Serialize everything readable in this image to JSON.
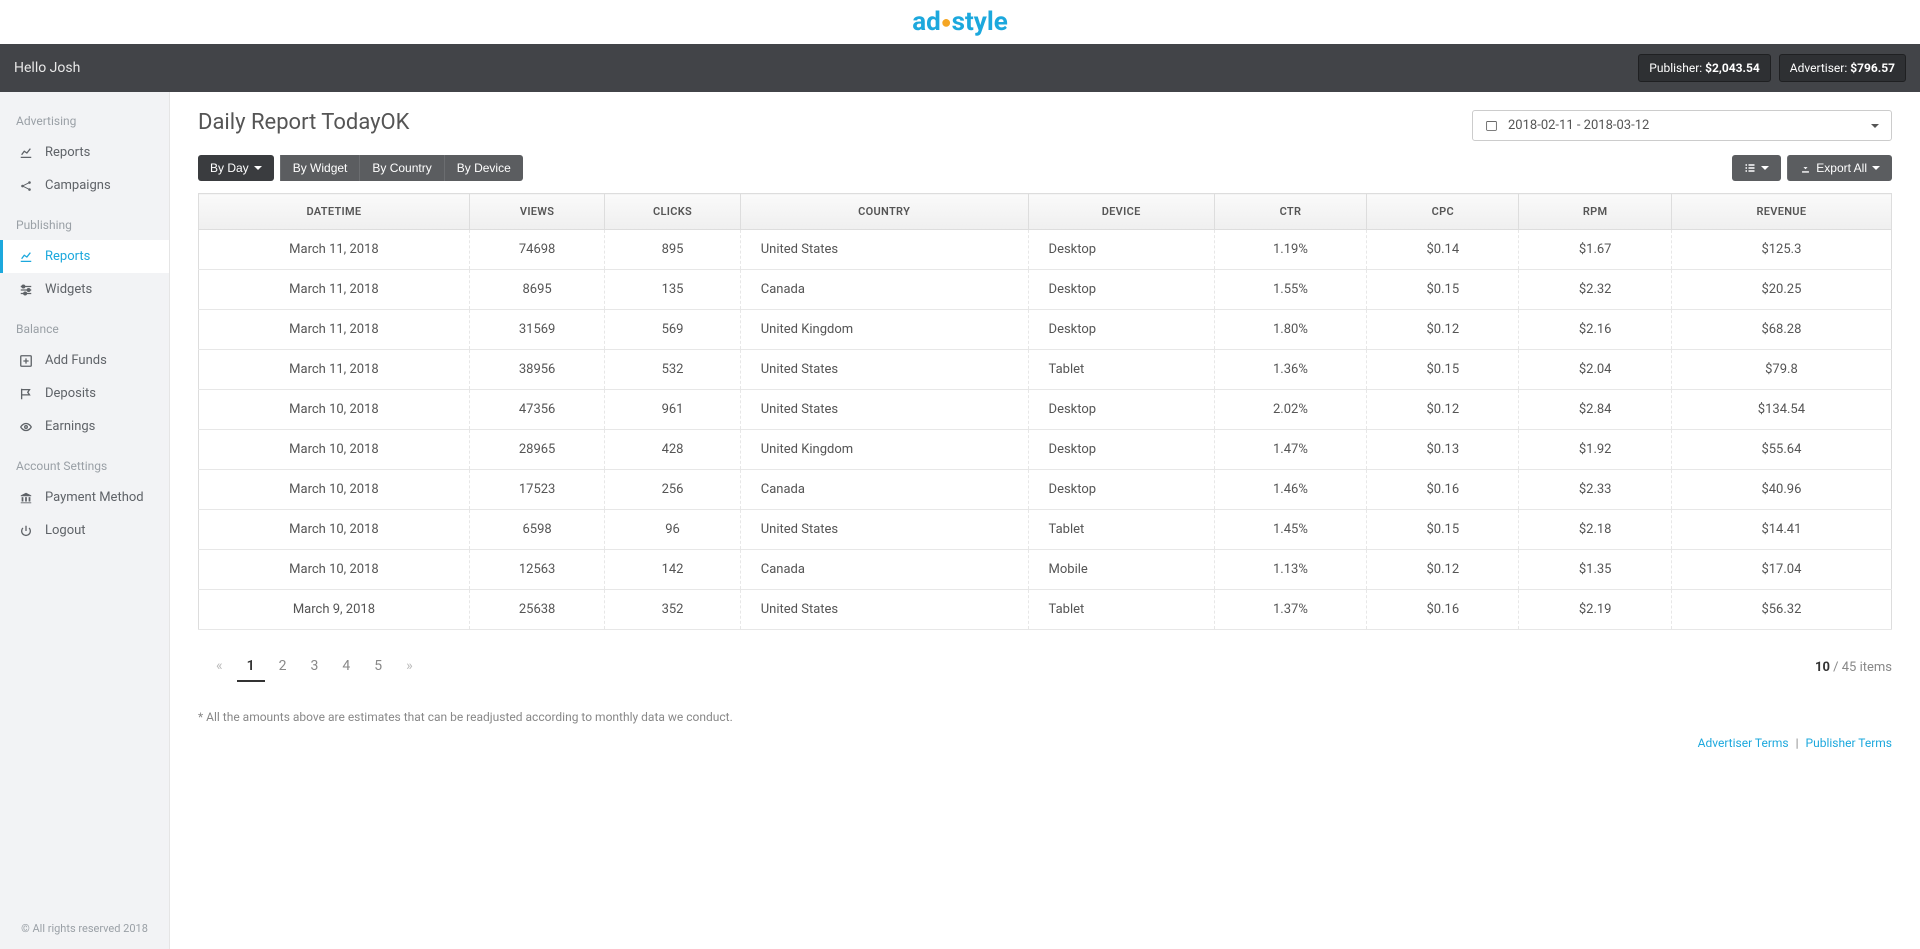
{
  "logo": {
    "part1": "ad",
    "part2": "style"
  },
  "header": {
    "greeting": "Hello Josh",
    "publisher_label": "Publisher: ",
    "publisher_value": "$2,043.54",
    "advertiser_label": "Advertiser: ",
    "advertiser_value": "$796.57"
  },
  "sidebar": {
    "advertising": {
      "heading": "Advertising",
      "reports": "Reports",
      "campaigns": "Campaigns"
    },
    "publishing": {
      "heading": "Publishing",
      "reports": "Reports",
      "widgets": "Widgets"
    },
    "balance": {
      "heading": "Balance",
      "add_funds": "Add Funds",
      "deposits": "Deposits",
      "earnings": "Earnings"
    },
    "account": {
      "heading": "Account Settings",
      "payment": "Payment Method",
      "logout": "Logout"
    },
    "copyright": "© All rights reserved 2018"
  },
  "page": {
    "title": "Daily Report TodayOK",
    "date_range": "2018-02-11 - 2018-03-12",
    "filters": {
      "by_day": "By Day",
      "by_widget": "By Widget",
      "by_country": "By Country",
      "by_device": "By Device"
    },
    "export": "Export All",
    "disclaimer": "* All the amounts above are estimates that can be readjusted according to monthly data we conduct.",
    "footer": {
      "adv_terms": "Advertiser Terms",
      "pub_terms": "Publisher Terms"
    }
  },
  "table": {
    "headers": {
      "datetime": "DATETIME",
      "views": "VIEWS",
      "clicks": "CLICKS",
      "country": "COUNTRY",
      "device": "DEVICE",
      "ctr": "CTR",
      "cpc": "CPC",
      "rpm": "RPM",
      "revenue": "REVENUE"
    },
    "rows": [
      {
        "datetime": "March 11, 2018",
        "views": "74698",
        "clicks": "895",
        "country": "United States",
        "device": "Desktop",
        "ctr": "1.19%",
        "cpc": "$0.14",
        "rpm": "$1.67",
        "revenue": "$125.3"
      },
      {
        "datetime": "March 11, 2018",
        "views": "8695",
        "clicks": "135",
        "country": "Canada",
        "device": "Desktop",
        "ctr": "1.55%",
        "cpc": "$0.15",
        "rpm": "$2.32",
        "revenue": "$20.25"
      },
      {
        "datetime": "March 11, 2018",
        "views": "31569",
        "clicks": "569",
        "country": "United Kingdom",
        "device": "Desktop",
        "ctr": "1.80%",
        "cpc": "$0.12",
        "rpm": "$2.16",
        "revenue": "$68.28"
      },
      {
        "datetime": "March 11, 2018",
        "views": "38956",
        "clicks": "532",
        "country": "United States",
        "device": "Tablet",
        "ctr": "1.36%",
        "cpc": "$0.15",
        "rpm": "$2.04",
        "revenue": "$79.8"
      },
      {
        "datetime": "March 10, 2018",
        "views": "47356",
        "clicks": "961",
        "country": "United States",
        "device": "Desktop",
        "ctr": "2.02%",
        "cpc": "$0.12",
        "rpm": "$2.84",
        "revenue": "$134.54"
      },
      {
        "datetime": "March 10, 2018",
        "views": "28965",
        "clicks": "428",
        "country": "United Kingdom",
        "device": "Desktop",
        "ctr": "1.47%",
        "cpc": "$0.13",
        "rpm": "$1.92",
        "revenue": "$55.64"
      },
      {
        "datetime": "March 10, 2018",
        "views": "17523",
        "clicks": "256",
        "country": "Canada",
        "device": "Desktop",
        "ctr": "1.46%",
        "cpc": "$0.16",
        "rpm": "$2.33",
        "revenue": "$40.96"
      },
      {
        "datetime": "March 10, 2018",
        "views": "6598",
        "clicks": "96",
        "country": "United States",
        "device": "Tablet",
        "ctr": "1.45%",
        "cpc": "$0.15",
        "rpm": "$2.18",
        "revenue": "$14.41"
      },
      {
        "datetime": "March 10, 2018",
        "views": "12563",
        "clicks": "142",
        "country": "Canada",
        "device": "Mobile",
        "ctr": "1.13%",
        "cpc": "$0.12",
        "rpm": "$1.35",
        "revenue": "$17.04"
      },
      {
        "datetime": "March 9, 2018",
        "views": "25638",
        "clicks": "352",
        "country": "United States",
        "device": "Tablet",
        "ctr": "1.37%",
        "cpc": "$0.16",
        "rpm": "$2.19",
        "revenue": "$56.32"
      }
    ]
  },
  "pagination": {
    "pages": [
      "«",
      "1",
      "2",
      "3",
      "4",
      "5",
      "»"
    ],
    "active": 1,
    "shown": "10",
    "total_text": " / 45 items"
  }
}
